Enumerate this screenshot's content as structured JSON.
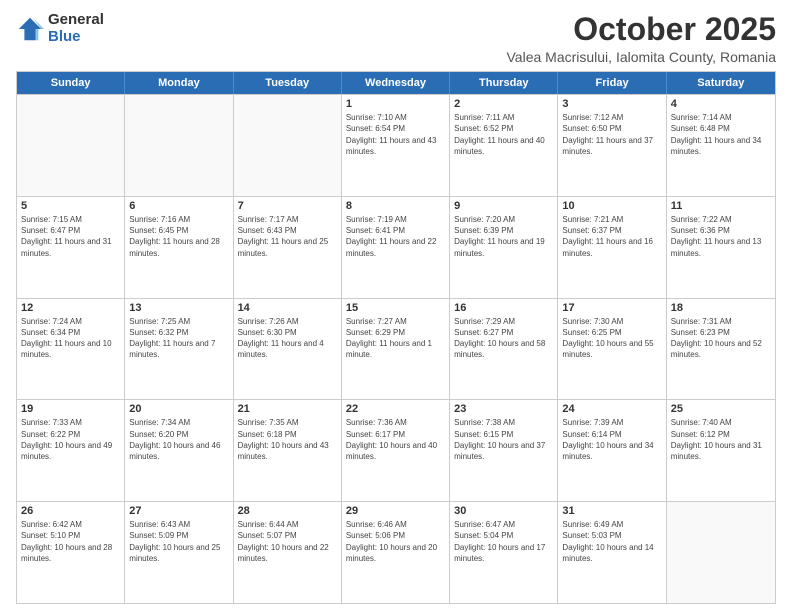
{
  "logo": {
    "general": "General",
    "blue": "Blue"
  },
  "title": "October 2025",
  "location": "Valea Macrisului, Ialomita County, Romania",
  "headers": [
    "Sunday",
    "Monday",
    "Tuesday",
    "Wednesday",
    "Thursday",
    "Friday",
    "Saturday"
  ],
  "weeks": [
    [
      {
        "day": "",
        "sunrise": "",
        "sunset": "",
        "daylight": ""
      },
      {
        "day": "",
        "sunrise": "",
        "sunset": "",
        "daylight": ""
      },
      {
        "day": "",
        "sunrise": "",
        "sunset": "",
        "daylight": ""
      },
      {
        "day": "1",
        "sunrise": "Sunrise: 7:10 AM",
        "sunset": "Sunset: 6:54 PM",
        "daylight": "Daylight: 11 hours and 43 minutes."
      },
      {
        "day": "2",
        "sunrise": "Sunrise: 7:11 AM",
        "sunset": "Sunset: 6:52 PM",
        "daylight": "Daylight: 11 hours and 40 minutes."
      },
      {
        "day": "3",
        "sunrise": "Sunrise: 7:12 AM",
        "sunset": "Sunset: 6:50 PM",
        "daylight": "Daylight: 11 hours and 37 minutes."
      },
      {
        "day": "4",
        "sunrise": "Sunrise: 7:14 AM",
        "sunset": "Sunset: 6:48 PM",
        "daylight": "Daylight: 11 hours and 34 minutes."
      }
    ],
    [
      {
        "day": "5",
        "sunrise": "Sunrise: 7:15 AM",
        "sunset": "Sunset: 6:47 PM",
        "daylight": "Daylight: 11 hours and 31 minutes."
      },
      {
        "day": "6",
        "sunrise": "Sunrise: 7:16 AM",
        "sunset": "Sunset: 6:45 PM",
        "daylight": "Daylight: 11 hours and 28 minutes."
      },
      {
        "day": "7",
        "sunrise": "Sunrise: 7:17 AM",
        "sunset": "Sunset: 6:43 PM",
        "daylight": "Daylight: 11 hours and 25 minutes."
      },
      {
        "day": "8",
        "sunrise": "Sunrise: 7:19 AM",
        "sunset": "Sunset: 6:41 PM",
        "daylight": "Daylight: 11 hours and 22 minutes."
      },
      {
        "day": "9",
        "sunrise": "Sunrise: 7:20 AM",
        "sunset": "Sunset: 6:39 PM",
        "daylight": "Daylight: 11 hours and 19 minutes."
      },
      {
        "day": "10",
        "sunrise": "Sunrise: 7:21 AM",
        "sunset": "Sunset: 6:37 PM",
        "daylight": "Daylight: 11 hours and 16 minutes."
      },
      {
        "day": "11",
        "sunrise": "Sunrise: 7:22 AM",
        "sunset": "Sunset: 6:36 PM",
        "daylight": "Daylight: 11 hours and 13 minutes."
      }
    ],
    [
      {
        "day": "12",
        "sunrise": "Sunrise: 7:24 AM",
        "sunset": "Sunset: 6:34 PM",
        "daylight": "Daylight: 11 hours and 10 minutes."
      },
      {
        "day": "13",
        "sunrise": "Sunrise: 7:25 AM",
        "sunset": "Sunset: 6:32 PM",
        "daylight": "Daylight: 11 hours and 7 minutes."
      },
      {
        "day": "14",
        "sunrise": "Sunrise: 7:26 AM",
        "sunset": "Sunset: 6:30 PM",
        "daylight": "Daylight: 11 hours and 4 minutes."
      },
      {
        "day": "15",
        "sunrise": "Sunrise: 7:27 AM",
        "sunset": "Sunset: 6:29 PM",
        "daylight": "Daylight: 11 hours and 1 minute."
      },
      {
        "day": "16",
        "sunrise": "Sunrise: 7:29 AM",
        "sunset": "Sunset: 6:27 PM",
        "daylight": "Daylight: 10 hours and 58 minutes."
      },
      {
        "day": "17",
        "sunrise": "Sunrise: 7:30 AM",
        "sunset": "Sunset: 6:25 PM",
        "daylight": "Daylight: 10 hours and 55 minutes."
      },
      {
        "day": "18",
        "sunrise": "Sunrise: 7:31 AM",
        "sunset": "Sunset: 6:23 PM",
        "daylight": "Daylight: 10 hours and 52 minutes."
      }
    ],
    [
      {
        "day": "19",
        "sunrise": "Sunrise: 7:33 AM",
        "sunset": "Sunset: 6:22 PM",
        "daylight": "Daylight: 10 hours and 49 minutes."
      },
      {
        "day": "20",
        "sunrise": "Sunrise: 7:34 AM",
        "sunset": "Sunset: 6:20 PM",
        "daylight": "Daylight: 10 hours and 46 minutes."
      },
      {
        "day": "21",
        "sunrise": "Sunrise: 7:35 AM",
        "sunset": "Sunset: 6:18 PM",
        "daylight": "Daylight: 10 hours and 43 minutes."
      },
      {
        "day": "22",
        "sunrise": "Sunrise: 7:36 AM",
        "sunset": "Sunset: 6:17 PM",
        "daylight": "Daylight: 10 hours and 40 minutes."
      },
      {
        "day": "23",
        "sunrise": "Sunrise: 7:38 AM",
        "sunset": "Sunset: 6:15 PM",
        "daylight": "Daylight: 10 hours and 37 minutes."
      },
      {
        "day": "24",
        "sunrise": "Sunrise: 7:39 AM",
        "sunset": "Sunset: 6:14 PM",
        "daylight": "Daylight: 10 hours and 34 minutes."
      },
      {
        "day": "25",
        "sunrise": "Sunrise: 7:40 AM",
        "sunset": "Sunset: 6:12 PM",
        "daylight": "Daylight: 10 hours and 31 minutes."
      }
    ],
    [
      {
        "day": "26",
        "sunrise": "Sunrise: 6:42 AM",
        "sunset": "Sunset: 5:10 PM",
        "daylight": "Daylight: 10 hours and 28 minutes."
      },
      {
        "day": "27",
        "sunrise": "Sunrise: 6:43 AM",
        "sunset": "Sunset: 5:09 PM",
        "daylight": "Daylight: 10 hours and 25 minutes."
      },
      {
        "day": "28",
        "sunrise": "Sunrise: 6:44 AM",
        "sunset": "Sunset: 5:07 PM",
        "daylight": "Daylight: 10 hours and 22 minutes."
      },
      {
        "day": "29",
        "sunrise": "Sunrise: 6:46 AM",
        "sunset": "Sunset: 5:06 PM",
        "daylight": "Daylight: 10 hours and 20 minutes."
      },
      {
        "day": "30",
        "sunrise": "Sunrise: 6:47 AM",
        "sunset": "Sunset: 5:04 PM",
        "daylight": "Daylight: 10 hours and 17 minutes."
      },
      {
        "day": "31",
        "sunrise": "Sunrise: 6:49 AM",
        "sunset": "Sunset: 5:03 PM",
        "daylight": "Daylight: 10 hours and 14 minutes."
      },
      {
        "day": "",
        "sunrise": "",
        "sunset": "",
        "daylight": ""
      }
    ]
  ]
}
